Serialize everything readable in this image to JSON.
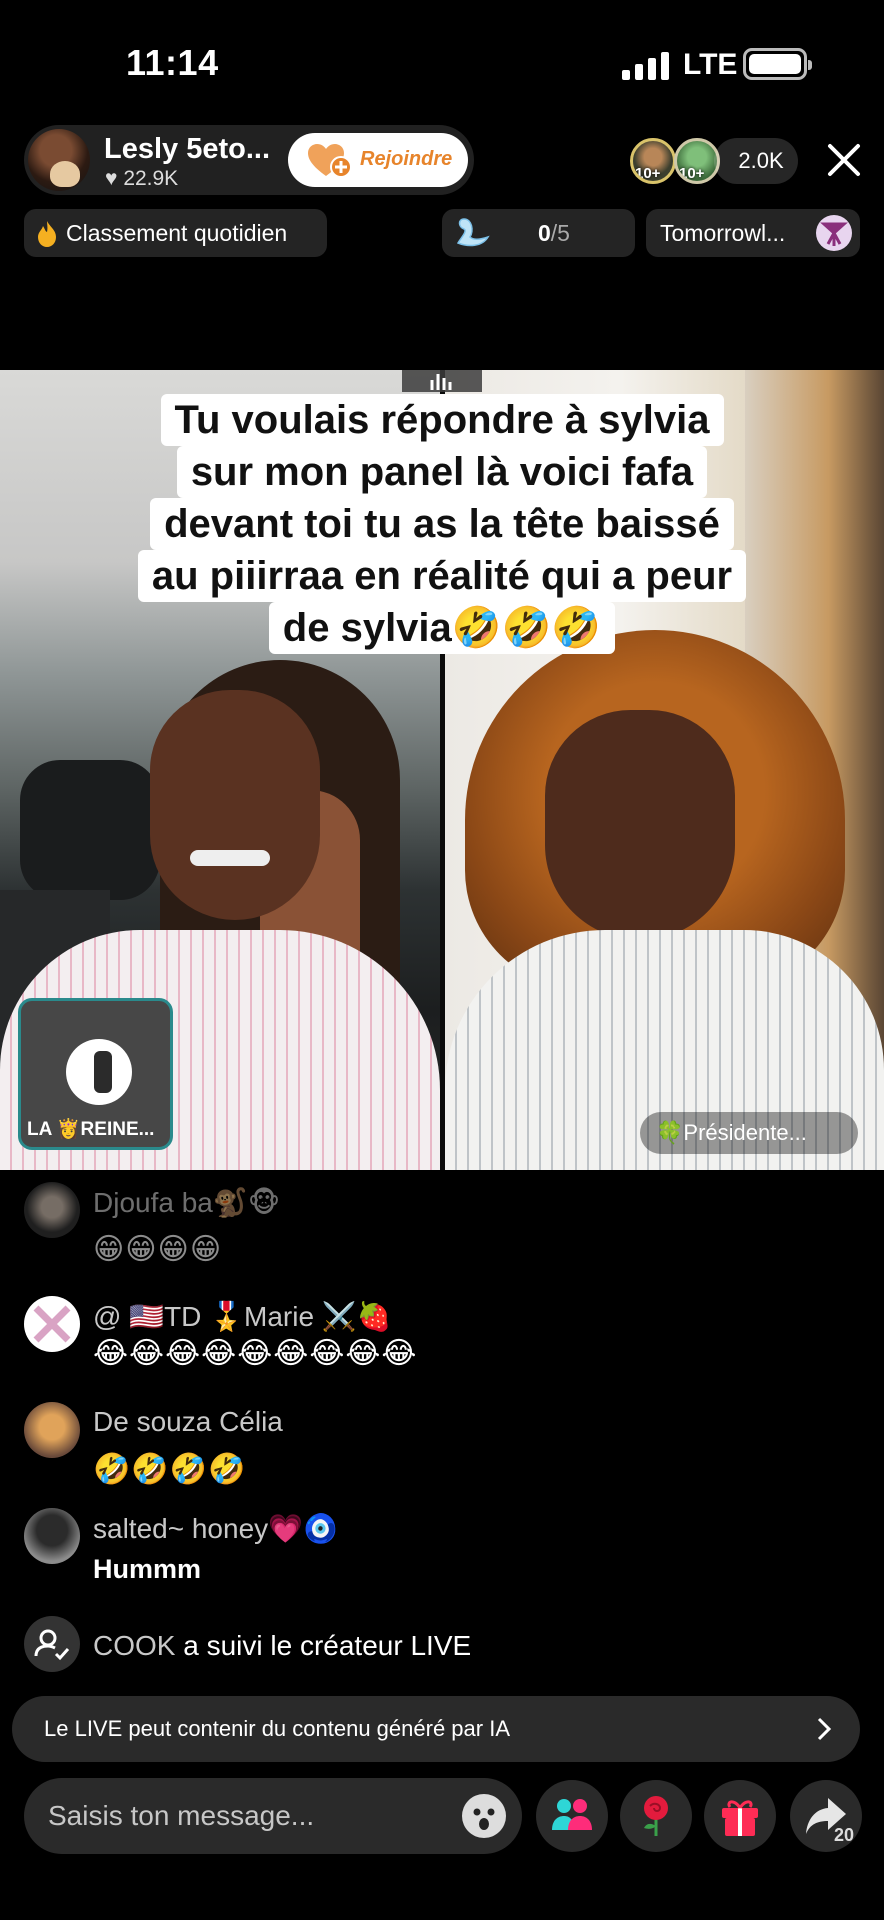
{
  "status_bar": {
    "time": "11:14",
    "network": "LTE"
  },
  "host": {
    "name": "Lesly 5eto...",
    "likes": "22.9K",
    "join_label": "Rejoindre"
  },
  "viewers": {
    "badge1": "10+",
    "badge2": "10+",
    "count": "2.0K"
  },
  "pills": {
    "ranking": "Classement quotidien",
    "goal_current": "0",
    "goal_total": "/5",
    "promo": "Tomorrowl..."
  },
  "video": {
    "caption_lines": [
      "Tu voulais répondre à sylvia",
      "sur mon panel là voici fafa",
      "devant toi tu as la tête baissé",
      "au piiirraa en réalité qui a peur",
      "de sylvia🤣🤣🤣"
    ],
    "guest_label": "LA 👸REINE...",
    "right_name": "🍀Présidente..."
  },
  "comments": [
    {
      "user": "Djoufa ba🐒🐵",
      "message": "😁😁😁😁"
    },
    {
      "user": "@ 🇺🇸TD 🎖️Marie ⚔️🍓",
      "message": "😂😂😂😂😂😂😂😂😂"
    },
    {
      "user": "De souza Célia",
      "message": "🤣🤣🤣🤣"
    },
    {
      "user": "salted~ honey💗🧿",
      "message": "Hummm"
    }
  ],
  "follow_event": {
    "user": "COOK",
    "text": " a suivi le créateur LIVE"
  },
  "ai_notice": "Le LIVE peut contenir du contenu généré par IA",
  "input": {
    "placeholder": "Saisis ton message..."
  },
  "share_count": "20",
  "colors": {
    "join_text": "#e7842b",
    "guest_border": "#2a8a8c",
    "background": "#000000"
  }
}
